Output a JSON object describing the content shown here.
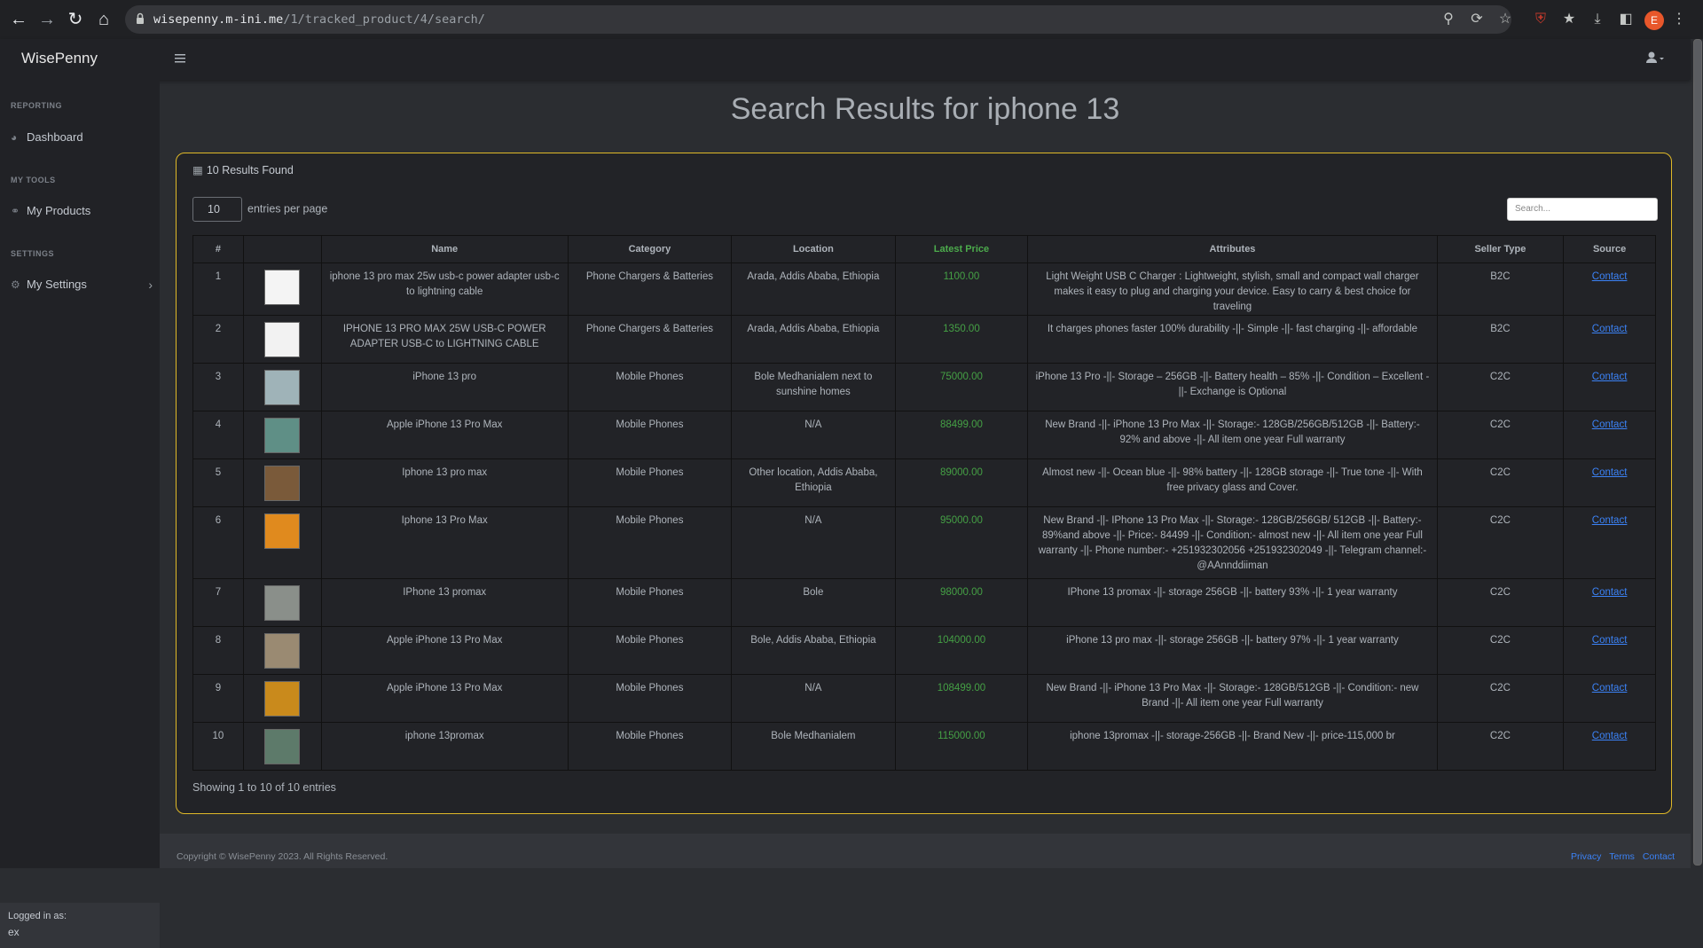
{
  "browser": {
    "url_domain": "wisepenny.m-ini.me",
    "url_path": "/1/tracked_product/4/search/",
    "profile_initial": "E"
  },
  "app": {
    "brand": "WisePenny"
  },
  "sidebar": {
    "sections": [
      {
        "heading": "REPORTING",
        "item": "Dashboard"
      },
      {
        "heading": "MY TOOLS",
        "item": "My Products"
      },
      {
        "heading": "SETTINGS",
        "item": "My Settings"
      }
    ],
    "logged_in_label": "Logged in as:",
    "logged_in_user": "ex"
  },
  "main": {
    "title": "Search Results for iphone 13",
    "results_found": "10 Results Found",
    "entries_value": "10",
    "entries_label": "entries per page",
    "search_placeholder": "Search...",
    "showing": "Showing 1 to 10 of 10 entries"
  },
  "table": {
    "headers": [
      "#",
      "",
      "Name",
      "Category",
      "Location",
      "Latest Price",
      "Attributes",
      "Seller Type",
      "Source"
    ],
    "rows": [
      {
        "n": "1",
        "name": "iphone 13 pro max 25w usb-c power adapter usb-c to lightning cable",
        "category": "Phone Chargers & Batteries",
        "location": "Arada, Addis Ababa, Ethiopia",
        "price": "1100.00",
        "attributes": "Light Weight USB C Charger : Lightweight, stylish, small and compact wall charger makes it easy to plug and charging your device. Easy to carry & best choice for traveling",
        "seller": "B2C",
        "source": "Contact",
        "thumb": "#f4f4f4"
      },
      {
        "n": "2",
        "name": "IPHONE 13 PRO MAX 25W USB-C POWER ADAPTER USB-C to LIGHTNING CABLE",
        "category": "Phone Chargers & Batteries",
        "location": "Arada, Addis Ababa, Ethiopia",
        "price": "1350.00",
        "attributes": "It charges phones faster 100% durability -||- Simple -||- fast charging -||- affordable",
        "seller": "B2C",
        "source": "Contact",
        "thumb": "#f2f2f2"
      },
      {
        "n": "3",
        "name": "iPhone 13 pro",
        "category": "Mobile Phones",
        "location": "Bole Medhanialem next to sunshine homes",
        "price": "75000.00",
        "attributes": "iPhone 13 Pro -||- Storage – 256GB -||- Battery health – 85% -||- Condition – Excellent -||- Exchange is Optional",
        "seller": "C2C",
        "source": "Contact",
        "thumb": "#9fb3b8"
      },
      {
        "n": "4",
        "name": "Apple iPhone 13 Pro Max",
        "category": "Mobile Phones",
        "location": "N/A",
        "price": "88499.00",
        "attributes": "New Brand -||- iPhone 13 Pro Max -||- Storage:- 128GB/256GB/512GB -||- Battery:- 92% and above -||- All item one year Full warranty",
        "seller": "C2C",
        "source": "Contact",
        "thumb": "#5f8f86"
      },
      {
        "n": "5",
        "name": "Iphone 13 pro max",
        "category": "Mobile Phones",
        "location": "Other location, Addis Ababa, Ethiopia",
        "price": "89000.00",
        "attributes": "Almost new -||- Ocean blue -||- 98% battery -||- 128GB storage -||- True tone -||- With free privacy glass and Cover.",
        "seller": "C2C",
        "source": "Contact",
        "thumb": "#7a5a3a"
      },
      {
        "n": "6",
        "name": "Iphone 13 Pro Max",
        "category": "Mobile Phones",
        "location": "N/A",
        "price": "95000.00",
        "attributes": "New Brand -||- IPhone 13 Pro Max -||- Storage:- 128GB/256GB/ 512GB -||- Battery:- 89%and above -||- Price:- 84499 -||- Condition:- almost new -||- All item one year Full warranty -||- Phone number:- +251932302056     +251932302049 -||- Telegram channel:- @AAnnddiiman",
        "seller": "C2C",
        "source": "Contact",
        "thumb": "#e08a1e"
      },
      {
        "n": "7",
        "name": "IPhone 13 promax",
        "category": "Mobile Phones",
        "location": "Bole",
        "price": "98000.00",
        "attributes": "IPhone 13 promax -||- storage 256GB -||- battery 93% -||- 1 year warranty",
        "seller": "C2C",
        "source": "Contact",
        "thumb": "#8a8f8a"
      },
      {
        "n": "8",
        "name": "Apple iPhone 13 Pro Max",
        "category": "Mobile Phones",
        "location": "Bole, Addis Ababa, Ethiopia",
        "price": "104000.00",
        "attributes": "iPhone 13 pro max -||- storage 256GB -||- battery 97% -||- 1 year warranty",
        "seller": "C2C",
        "source": "Contact",
        "thumb": "#9a8a72"
      },
      {
        "n": "9",
        "name": "Apple iPhone 13 Pro Max",
        "category": "Mobile Phones",
        "location": "N/A",
        "price": "108499.00",
        "attributes": "New Brand -||- iPhone 13 Pro Max -||- Storage:- 128GB/512GB -||- Condition:- new Brand -||- All item one year Full warranty",
        "seller": "C2C",
        "source": "Contact",
        "thumb": "#c98a1c"
      },
      {
        "n": "10",
        "name": "iphone 13promax",
        "category": "Mobile Phones",
        "location": "Bole Medhanialem",
        "price": "115000.00",
        "attributes": "iphone 13promax -||- storage-256GB -||- Brand New -||- price-115,000 br",
        "seller": "C2C",
        "source": "Contact",
        "thumb": "#5d7a6a"
      }
    ]
  },
  "footer": {
    "copyright": "Copyright © WisePenny 2023. All Rights Reserved.",
    "links": [
      "Privacy",
      "Terms",
      "Contact"
    ]
  }
}
